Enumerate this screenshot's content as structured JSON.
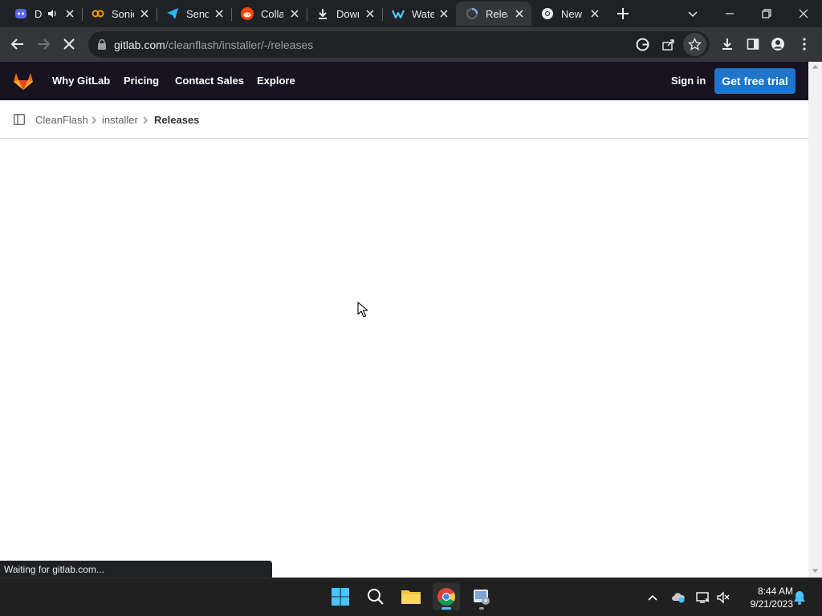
{
  "browser": {
    "tabs": [
      {
        "title": "D",
        "icon": "discord-app-icon",
        "audio": true
      },
      {
        "title": "Sonic",
        "icon": "sonic-infinity-icon"
      },
      {
        "title": "Send",
        "icon": "telegram-send-icon"
      },
      {
        "title": "Colla",
        "icon": "reddit-icon"
      },
      {
        "title": "Down",
        "icon": "download-icon"
      },
      {
        "title": "Wate",
        "icon": "waterfox-icon"
      },
      {
        "title": "Relea",
        "icon": "loading-spinner-icon",
        "active": true
      },
      {
        "title": "New",
        "icon": "chrome-icon"
      }
    ],
    "address": {
      "host": "gitlab.com",
      "path": "/cleanflash/installer/-/releases"
    },
    "status_text": "Waiting for gitlab.com..."
  },
  "gitlab_nav": {
    "links": [
      "Why GitLab",
      "Pricing",
      "Contact Sales",
      "Explore"
    ],
    "sign_in": "Sign in",
    "trial": "Get free trial"
  },
  "breadcrumb": {
    "items": [
      "CleanFlash",
      "installer"
    ],
    "current": "Releases"
  },
  "taskbar": {
    "time": "8:44 AM",
    "date": "9/21/2023"
  },
  "colors": {
    "gitlab_nav_bg": "#171321",
    "trial_button": "#1f75cb",
    "browser_frame": "#202124",
    "toolbar": "#35363a"
  }
}
